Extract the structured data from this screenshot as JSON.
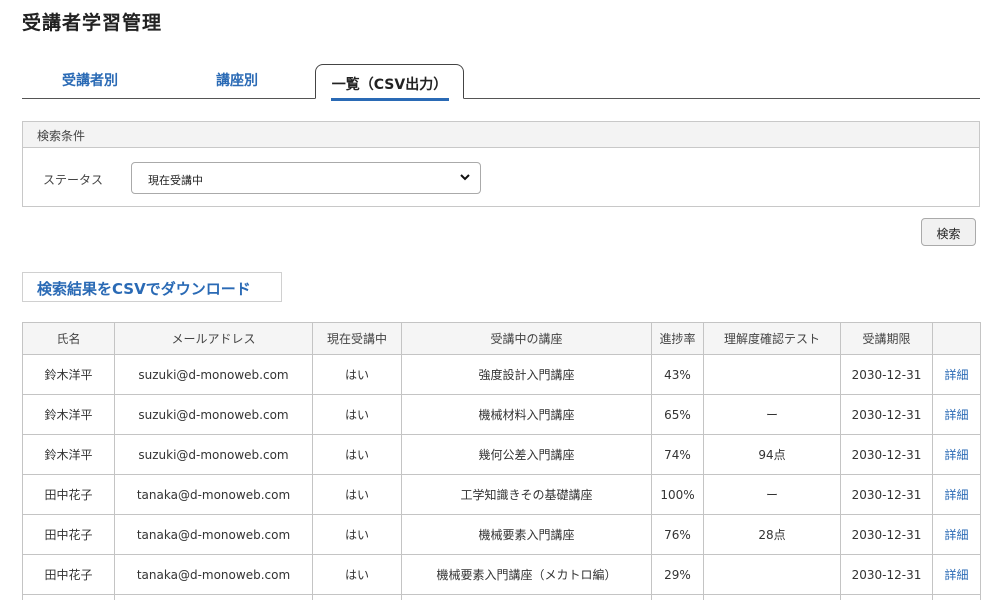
{
  "page": {
    "title": "受講者学習管理"
  },
  "tabs": [
    {
      "label": "受講者別"
    },
    {
      "label": "講座別"
    },
    {
      "label": "一覧（CSV出力）"
    }
  ],
  "search": {
    "header": "検索条件",
    "status_label": "ステータス",
    "status_value": "現在受講中",
    "button_label": "検索"
  },
  "csv_button_label": "検索結果をCSVでダウンロード",
  "table": {
    "headers": [
      "氏名",
      "メールアドレス",
      "現在受講中",
      "受講中の講座",
      "進捗率",
      "理解度確認テスト",
      "受講期限",
      ""
    ],
    "rows": [
      {
        "name": "鈴木洋平",
        "email": "suzuki@d-monoweb.com",
        "active": "はい",
        "course": "強度設計入門講座",
        "progress": "43%",
        "test": "",
        "deadline": "2030-12-31",
        "detail": "詳細"
      },
      {
        "name": "鈴木洋平",
        "email": "suzuki@d-monoweb.com",
        "active": "はい",
        "course": "機械材料入門講座",
        "progress": "65%",
        "test": "ー",
        "deadline": "2030-12-31",
        "detail": "詳細"
      },
      {
        "name": "鈴木洋平",
        "email": "suzuki@d-monoweb.com",
        "active": "はい",
        "course": "幾何公差入門講座",
        "progress": "74%",
        "test": "94点",
        "deadline": "2030-12-31",
        "detail": "詳細"
      },
      {
        "name": "田中花子",
        "email": "tanaka@d-monoweb.com",
        "active": "はい",
        "course": "工学知識きその基礎講座",
        "progress": "100%",
        "test": "ー",
        "deadline": "2030-12-31",
        "detail": "詳細"
      },
      {
        "name": "田中花子",
        "email": "tanaka@d-monoweb.com",
        "active": "はい",
        "course": "機械要素入門講座",
        "progress": "76%",
        "test": "28点",
        "deadline": "2030-12-31",
        "detail": "詳細"
      },
      {
        "name": "田中花子",
        "email": "tanaka@d-monoweb.com",
        "active": "はい",
        "course": "機械要素入門講座（メカトロ編）",
        "progress": "29%",
        "test": "",
        "deadline": "2030-12-31",
        "detail": "詳細"
      }
    ]
  },
  "colors": {
    "accent": "#2a6ab5",
    "border": "#c4c4c4",
    "header_bg": "#f5f5f5"
  },
  "icons": {
    "select_arrow": "chevron-down-icon"
  }
}
